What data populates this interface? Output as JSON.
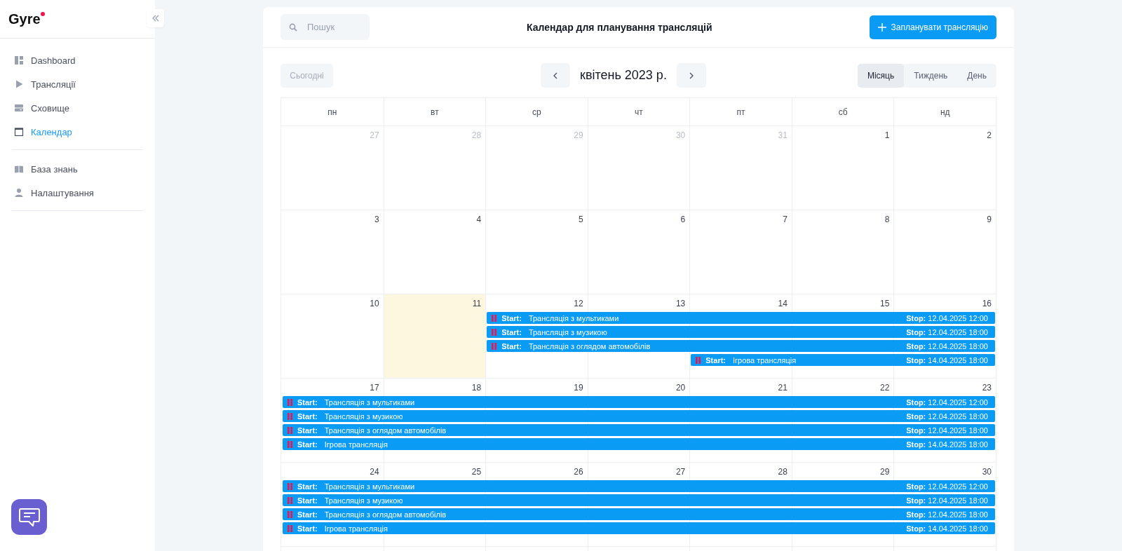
{
  "sidebar": {
    "logo": "Gyre",
    "groups": [
      {
        "items": [
          {
            "label": "Dashboard",
            "selected": false
          },
          {
            "label": "Трансляції",
            "selected": false
          },
          {
            "label": "Сховище",
            "selected": false
          },
          {
            "label": "Календар",
            "selected": true
          }
        ]
      },
      {
        "items": [
          {
            "label": "База знань",
            "selected": false
          },
          {
            "label": "Налаштування",
            "selected": false
          }
        ]
      }
    ]
  },
  "header": {
    "search": {
      "placeholder": "Пошук"
    },
    "title": "Календар для планування трансляцій",
    "action": "Запланувати трансляцію"
  },
  "toolbar": {
    "today": {
      "label": "Сьогодні",
      "disabled": true
    },
    "period": "квітень 2023 р.",
    "views": [
      {
        "label": "Місяць",
        "selected": true
      },
      {
        "label": "Тиждень",
        "selected": false
      },
      {
        "label": "День",
        "selected": false
      }
    ]
  },
  "calendar": {
    "weekdays": [
      "пн",
      "вт",
      "ср",
      "чт",
      "пт",
      "сб",
      "нд"
    ],
    "weeks": [
      {
        "days": [
          {
            "label": "27",
            "outside": true,
            "today": false
          },
          {
            "label": "28",
            "outside": true,
            "today": false
          },
          {
            "label": "29",
            "outside": true,
            "today": false
          },
          {
            "label": "30",
            "outside": true,
            "today": false
          },
          {
            "label": "31",
            "outside": true,
            "today": false
          },
          {
            "label": "1",
            "outside": false,
            "today": false
          },
          {
            "label": "2",
            "outside": false,
            "today": false
          }
        ]
      },
      {
        "days": [
          {
            "label": "3",
            "outside": false,
            "today": false
          },
          {
            "label": "4",
            "outside": false,
            "today": false
          },
          {
            "label": "5",
            "outside": false,
            "today": false
          },
          {
            "label": "6",
            "outside": false,
            "today": false
          },
          {
            "label": "7",
            "outside": false,
            "today": false
          },
          {
            "label": "8",
            "outside": false,
            "today": false
          },
          {
            "label": "9",
            "outside": false,
            "today": false
          }
        ]
      },
      {
        "days": [
          {
            "label": "10",
            "outside": false,
            "today": false
          },
          {
            "label": "11",
            "outside": false,
            "today": true
          },
          {
            "label": "12",
            "outside": false,
            "today": false,
            "events": [
              {
                "start_label": "Start:",
                "title": "Трансляція з мультиками",
                "stop": "**Stop:** 12.04.2025 12:00"
              },
              {
                "start_label": "Start:",
                "title": "Трансляція з музикою",
                "stop": "**Stop:** 12.04.2025 18:00"
              },
              {
                "start_label": "Start:",
                "title": "Трансляція з оглядом автомобілів",
                "stop": "**Stop:** 12.04.2025 18:00"
              }
            ]
          },
          {
            "label": "13",
            "outside": false,
            "today": false
          },
          {
            "label": "14",
            "outside": false,
            "today": false,
            "events": [
              {
                "start_label": "Start:",
                "title": "Ігрова трансляція",
                "stop": "**Stop:** 14.04.2025 18:00"
              }
            ]
          },
          {
            "label": "15",
            "outside": false,
            "today": false
          },
          {
            "label": "16",
            "outside": false,
            "today": false
          }
        ]
      },
      {
        "days": [
          {
            "label": "17",
            "outside": false,
            "today": false,
            "events": [
              {
                "start_label": "Start:",
                "title": "Трансляція з мультиками",
                "stop": "**Stop:** 12.04.2025 12:00"
              },
              {
                "start_label": "Start:",
                "title": "Трансляція з музикою",
                "stop": "**Stop:** 12.04.2025 18:00"
              },
              {
                "start_label": "Start:",
                "title": "Трансляція з оглядом автомобілів",
                "stop": "**Stop:** 12.04.2025 18:00"
              },
              {
                "start_label": "Start:",
                "title": "Ігрова трансляція",
                "stop": "**Stop:** 14.04.2025 18:00"
              }
            ]
          },
          {
            "label": "18",
            "outside": false,
            "today": false
          },
          {
            "label": "19",
            "outside": false,
            "today": false
          },
          {
            "label": "20",
            "outside": false,
            "today": false
          },
          {
            "label": "21",
            "outside": false,
            "today": false
          },
          {
            "label": "22",
            "outside": false,
            "today": false
          },
          {
            "label": "23",
            "outside": false,
            "today": false
          }
        ]
      },
      {
        "days": [
          {
            "label": "24",
            "outside": false,
            "today": false,
            "events": [
              {
                "start_label": "Start:",
                "title": "Трансляція з мультиками",
                "stop": "**Stop:** 12.04.2025 12:00"
              },
              {
                "start_label": "Start:",
                "title": "Трансляція з музикою",
                "stop": "**Stop:** 12.04.2025 18:00"
              },
              {
                "start_label": "Start:",
                "title": "Трансляція з оглядом автомобілів",
                "stop": "**Stop:** 12.04.2025 18:00"
              },
              {
                "start_label": "Start:",
                "title": "Ігрова трансляція",
                "stop": "**Stop:** 14.04.2025 18:00"
              }
            ]
          },
          {
            "label": "25",
            "outside": false,
            "today": false
          },
          {
            "label": "26",
            "outside": false,
            "today": false
          },
          {
            "label": "27",
            "outside": false,
            "today": false
          },
          {
            "label": "28",
            "outside": false,
            "today": false
          },
          {
            "label": "29",
            "outside": false,
            "today": false
          },
          {
            "label": "30",
            "outside": false,
            "today": false
          }
        ]
      }
    ]
  }
}
